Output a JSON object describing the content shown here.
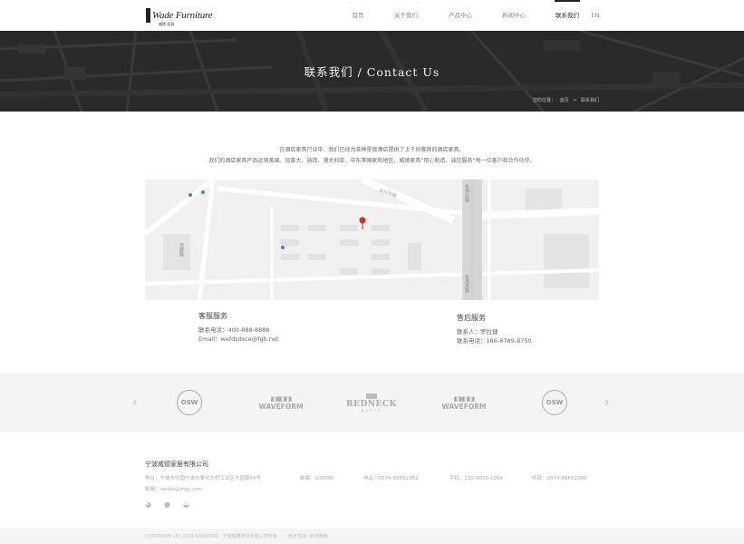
{
  "header": {
    "logo_text": "Wade Furniture",
    "logo_sub": "威德 家具",
    "nav": [
      {
        "label": "首页"
      },
      {
        "label": "关于我们"
      },
      {
        "label": "产品中心"
      },
      {
        "label": "新闻中心"
      },
      {
        "label": "联系我们"
      },
      {
        "label": "EN"
      }
    ]
  },
  "banner": {
    "title": "联系我们 / Contact Us",
    "breadcrumb_prefix": "您的位置：",
    "breadcrumb_home": "首页",
    "breadcrumb_sep": ">",
    "breadcrumb_current": "联系我们"
  },
  "intro": {
    "line1": "在酒店家具行业中，我们已经为各种星级酒店提供了上千间客房的酒店家具。",
    "line2": "我们的酒店家具产品远销美国、加拿大、迪拜、澳大利亚、中东等国家和地区，威德家具“用心制造、诚信服务”每一位客户和合作伙伴。"
  },
  "map": {
    "labels": {
      "street_a": "长兴东路",
      "street_b": "机场北路",
      "street_c": "机场南路",
      "street_d": "洪都路"
    }
  },
  "contact": {
    "service": {
      "title": "客服服务",
      "phone": "联系电话：400-888-8888",
      "email": "Email：wefdsdsce@fgb.net"
    },
    "after_sales": {
      "title": "售后服务",
      "person": "联系人：罗拉捷",
      "phone": "联系电话：186-6789-8750"
    }
  },
  "partners": {
    "items": [
      {
        "name": "OSW"
      },
      {
        "name": "WAVEFORM"
      },
      {
        "name": "REDNECK",
        "sub": "BOOTS"
      },
      {
        "name": "WAVEFORM"
      },
      {
        "name": "OSW"
      }
    ],
    "prev": "‹",
    "next": "›"
  },
  "footer": {
    "company": "宁波威德家居有限公司",
    "address": "地址：宁波市中国宁波市奉化方桥工业区方园路54号",
    "postcode": "邮编：100000",
    "tel": "电话：0574-88652382",
    "mobile": "手机：159-9050-1094",
    "fax": "传真：0574-88652380",
    "email": "邮箱：weide@zhjg.com",
    "copyright": "COPYRIGHT (©) 2019 00000000 · 宁波威德家具有限公司所有",
    "tech": "技术支持: 新鸿网络"
  }
}
